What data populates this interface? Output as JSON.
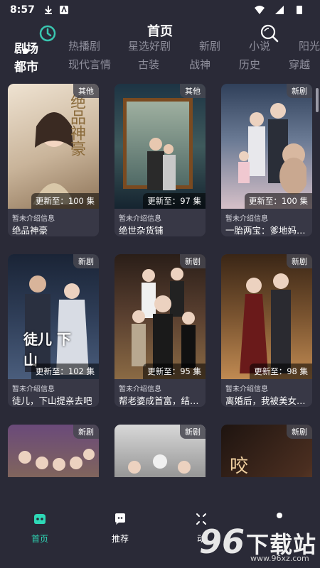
{
  "status_bar": {
    "time": "8:57"
  },
  "header": {
    "title": "首页"
  },
  "categories_row1": [
    {
      "label": "剧场",
      "active": true
    },
    {
      "label": "热播剧",
      "active": false
    },
    {
      "label": "星选好剧",
      "active": false
    },
    {
      "label": "新剧",
      "active": false
    },
    {
      "label": "小说",
      "active": false
    },
    {
      "label": "阳光",
      "active": false
    }
  ],
  "categories_row2": [
    {
      "label": "都市",
      "active": true
    },
    {
      "label": "现代言情",
      "active": false
    },
    {
      "label": "古装",
      "active": false
    },
    {
      "label": "战神",
      "active": false
    },
    {
      "label": "历史",
      "active": false
    },
    {
      "label": "穿越",
      "active": false
    }
  ],
  "cards": [
    {
      "tag": "其他",
      "episodes": "更新至：100 集",
      "info": "暂未介绍信息",
      "name": "绝品神豪",
      "poster_text": "绝品神豪",
      "colors": [
        "#e9d9c6",
        "#b79a7d"
      ]
    },
    {
      "tag": "其他",
      "episodes": "更新至：97 集",
      "info": "暂未介绍信息",
      "name": "绝世杂货铺",
      "poster_text": "",
      "colors": [
        "#2a3a4a",
        "#7c8a82"
      ]
    },
    {
      "tag": "新剧",
      "episodes": "更新至：100 集",
      "info": "暂未介绍信息",
      "name": "一胎两宝：爹地妈咪…",
      "poster_text": "",
      "colors": [
        "#3a4a66",
        "#c9cfd8"
      ]
    },
    {
      "tag": "新剧",
      "episodes": "更新至：102 集",
      "info": "暂未介绍信息",
      "name": "徒儿，下山提亲去吧",
      "poster_text": "徒儿 下山",
      "colors": [
        "#1c2638",
        "#5a6f8a"
      ]
    },
    {
      "tag": "新剧",
      "episodes": "更新至：95 集",
      "info": "暂未介绍信息",
      "name": "帮老婆成首富，结果…",
      "poster_text": "",
      "colors": [
        "#3a2a22",
        "#9a7a56"
      ]
    },
    {
      "tag": "新剧",
      "episodes": "更新至：98 集",
      "info": "暂未介绍信息",
      "name": "离婚后，我被美女包…",
      "poster_text": "",
      "colors": [
        "#4a3222",
        "#c09060"
      ]
    },
    {
      "tag": "新剧",
      "episodes": "",
      "info": "",
      "name": "",
      "poster_text": "",
      "colors": [
        "#5a3a6a",
        "#a09060"
      ]
    },
    {
      "tag": "新剧",
      "episodes": "",
      "info": "",
      "name": "",
      "poster_text": "",
      "colors": [
        "#222222",
        "#d0d0d0"
      ]
    },
    {
      "tag": "新剧",
      "episodes": "",
      "info": "",
      "name": "",
      "poster_text": "咬",
      "colors": [
        "#2a1a14",
        "#8a5a3a"
      ]
    }
  ],
  "bottom_nav": [
    {
      "label": "首页",
      "icon": "gamepad-icon",
      "active": true
    },
    {
      "label": "推荐",
      "icon": "chat-bubble-icon",
      "active": false
    },
    {
      "label": "动",
      "icon": "grid-icon",
      "active": false
    },
    {
      "label": "",
      "icon": "user-icon",
      "active": false
    }
  ],
  "watermark": {
    "number": "96",
    "text": "下载站",
    "url": "www.96xz.com"
  },
  "colors": {
    "background": "#2a2a37",
    "card": "#383846",
    "accent": "#2ed8b6",
    "clock_icon": "#39c6b0"
  }
}
